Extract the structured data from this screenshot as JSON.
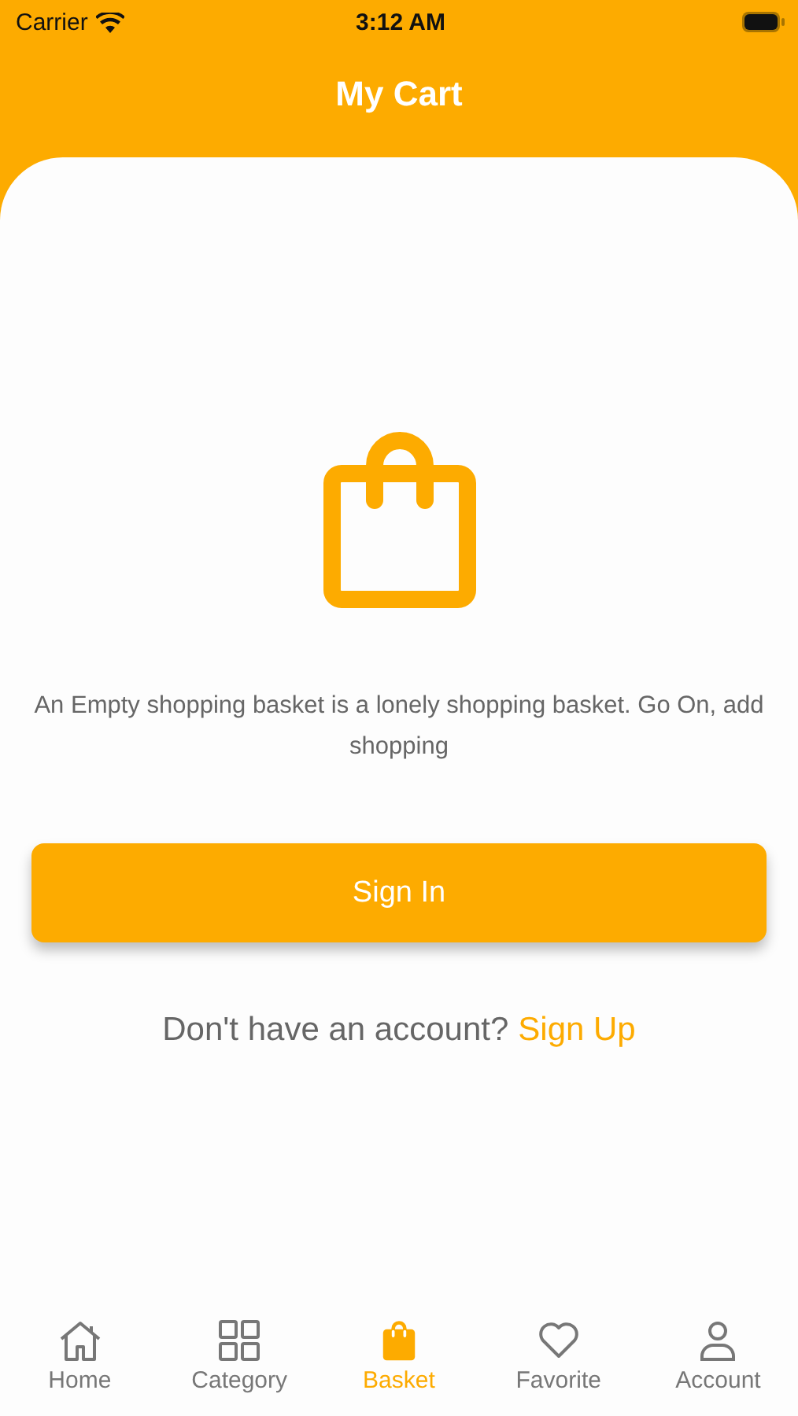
{
  "status_bar": {
    "carrier": "Carrier",
    "time": "3:12 AM"
  },
  "header": {
    "title": "My Cart"
  },
  "empty_state": {
    "message": "An Empty shopping basket is a lonely shopping basket. Go On, add shopping"
  },
  "sign_in_button": "Sign In",
  "sign_up_prompt": {
    "text": "Don't have an account?",
    "link": "Sign Up"
  },
  "tab_bar": [
    {
      "label": "Home",
      "selected": false
    },
    {
      "label": "Category",
      "selected": false
    },
    {
      "label": "Basket",
      "selected": true
    },
    {
      "label": "Favorite",
      "selected": false
    },
    {
      "label": "Account",
      "selected": false
    }
  ]
}
